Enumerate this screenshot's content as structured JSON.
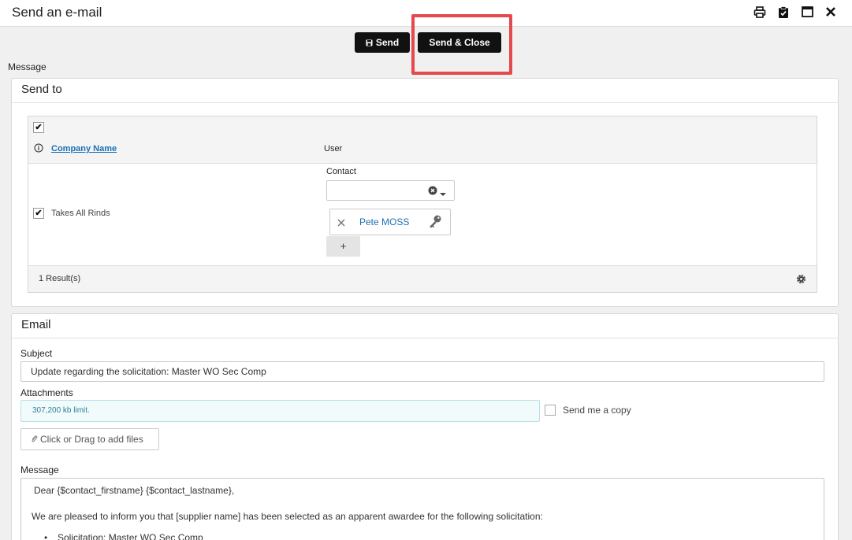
{
  "window": {
    "title": "Send an e-mail",
    "icons": [
      "print-icon",
      "clipboard-check-icon",
      "maximize-icon",
      "close-icon"
    ]
  },
  "toolbar": {
    "send_label": "Send",
    "send_close_label": "Send & Close"
  },
  "message_label": "Message",
  "send_to": {
    "title": "Send to",
    "columns": {
      "company": "Company Name",
      "user": "User"
    },
    "row": {
      "company": "Takes All Rinds",
      "contact_label": "Contact",
      "contact_value": "",
      "chip_name": "Pete MOSS",
      "add_label": "+"
    },
    "results": "1 Result(s)"
  },
  "email": {
    "title": "Email",
    "subject_label": "Subject",
    "subject_value": "Update regarding the solicitation: Master WO Sec Comp",
    "attachments_label": "Attachments",
    "attachments_hint": "307,200 kb limit.",
    "send_copy_label": "Send me a copy",
    "add_files_label": "Click or Drag to add files",
    "message_label": "Message",
    "message_lines": [
      "Dear {$contact_firstname} {$contact_lastname},",
      "We are pleased to inform you that [supplier name] has been selected as an apparent awardee for the following solicitation:",
      "Solicitation: Master WO Sec Comp"
    ]
  }
}
